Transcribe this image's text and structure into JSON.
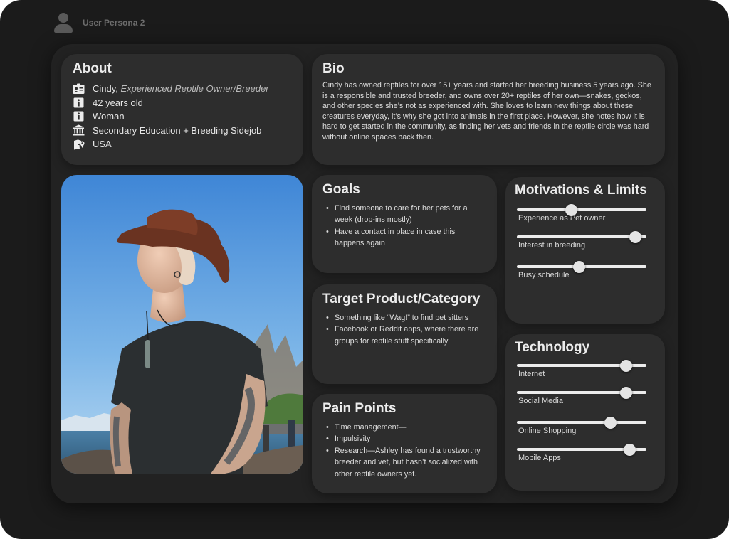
{
  "window": {
    "title": "User Persona 2"
  },
  "about": {
    "title": "About",
    "name": "Cindy,",
    "role": "Experienced Reptile Owner/Breeder",
    "age": "42 years old",
    "gender": "Woman",
    "education": "Secondary Education + Breeding Sidejob",
    "location": "USA",
    "icons": [
      "id-card-icon",
      "info-icon",
      "info-icon",
      "institution-icon",
      "location-icon"
    ]
  },
  "bio": {
    "title": "Bio",
    "text": "Cindy has owned reptiles for over 15+ years and started her breeding business 5 years ago. She is a responsible and trusted breeder, and owns over 20+ reptiles of her own—snakes, geckos, and other species she’s not as experienced with. She loves to learn new things about these creatures everyday, it’s why she got into animals in the first place. However, she notes how it is hard to get started in the community, as finding her vets and friends in the reptile circle was hard without online spaces back then."
  },
  "goals": {
    "title": "Goals",
    "items": [
      "Find someone to care for her pets for a week (drop-ins mostly)",
      "Have a contact in place in case this happens again"
    ]
  },
  "target": {
    "title": "Target Product/Category",
    "items": [
      "Something like “Wag!” to find pet sitters",
      "Facebook or Reddit apps, where there are groups for reptile stuff specifically"
    ]
  },
  "pain": {
    "title": "Pain Points",
    "items": [
      "Time management—",
      "Impulsivity",
      "Research—Ashley has found a trustworthy breeder and vet, but hasn’t socialized with other reptile owners yet."
    ]
  },
  "motivations": {
    "title": "Motivations & Limits",
    "sliders": [
      {
        "label": "Experience as Pet owner",
        "level": 0.42
      },
      {
        "label": "Interest in breeding",
        "level": 0.91
      },
      {
        "label": "Busy schedule",
        "level": 0.48
      }
    ]
  },
  "technology": {
    "title": "Technology",
    "sliders": [
      {
        "label": "Internet",
        "level": 0.84
      },
      {
        "label": "Social Media",
        "level": 0.84
      },
      {
        "label": "Online Shopping",
        "level": 0.72
      },
      {
        "label": "Mobile Apps",
        "level": 0.87
      }
    ]
  },
  "colors": {
    "frame": "#1b1b1b",
    "board": "#222222",
    "card": "#2d2d2d",
    "text": "#e6e6e6"
  }
}
